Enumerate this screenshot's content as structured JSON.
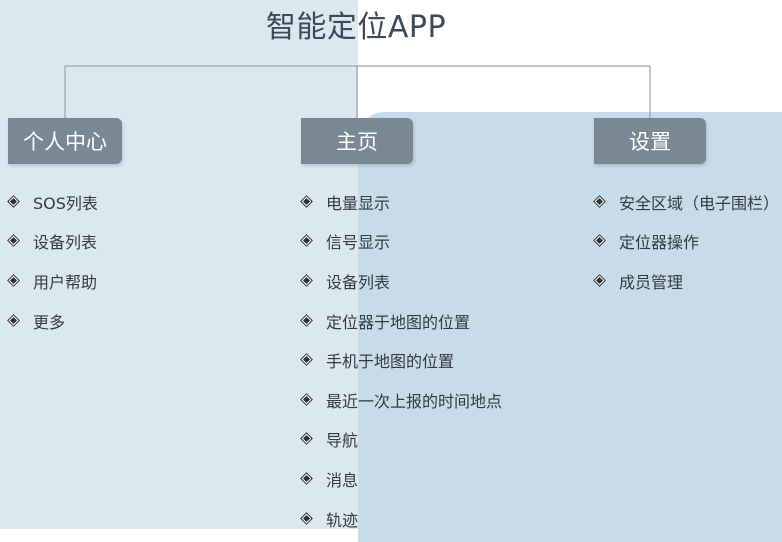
{
  "title": "智能定位APP",
  "columns": [
    {
      "header": "个人中心",
      "items": [
        "SOS列表",
        "设备列表",
        "用户帮助",
        "更多"
      ]
    },
    {
      "header": "主页",
      "items": [
        "电量显示",
        "信号显示",
        "设备列表",
        "定位器于地图的位置",
        "手机于地图的位置",
        "最近一次上报的时间地点",
        "导航",
        "消息",
        "轨迹"
      ]
    },
    {
      "header": "设置",
      "items": [
        "安全区域（电子围栏）",
        "定位器操作",
        "成员管理"
      ]
    }
  ],
  "icons": {
    "bullet": "diamond-bullet-icon"
  },
  "colors": {
    "header_bg": "#7a8895",
    "left_panel_bg": "#dce8f0",
    "right_panel_bg": "#c7dce8",
    "title_color": "#3e4a55"
  }
}
